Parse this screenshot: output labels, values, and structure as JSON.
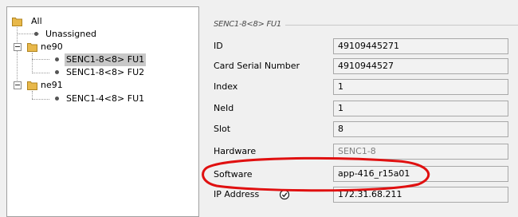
{
  "tree": {
    "root": {
      "label": "All"
    },
    "unassigned": {
      "label": "Unassigned"
    },
    "ne90": {
      "label": "ne90",
      "children": [
        {
          "label": "SENC1-8<8> FU1",
          "selected": true
        },
        {
          "label": "SENC1-8<8> FU2",
          "selected": false
        }
      ]
    },
    "ne91": {
      "label": "ne91",
      "children": [
        {
          "label": "SENC1-4<8> FU1",
          "selected": false
        }
      ]
    }
  },
  "details": {
    "section_title": "SENC1-8<8> FU1",
    "fields": [
      {
        "label": "ID",
        "value": "49109445271"
      },
      {
        "label": "Card Serial Number",
        "value": "4910944527"
      },
      {
        "label": "Index",
        "value": "1"
      },
      {
        "label": "NeId",
        "value": "1"
      },
      {
        "label": "Slot",
        "value": "8"
      },
      {
        "label": "Hardware",
        "value": "SENC1-8"
      },
      {
        "label": "Software",
        "value": "app-416_r15a01"
      },
      {
        "label": "IP Address",
        "value": "172.31.68.211"
      }
    ]
  },
  "colors": {
    "folder": "#e8b84a",
    "selection": "#c8c8c8",
    "annotation": "#e01010"
  },
  "icons": {
    "folder": "folder-icon",
    "ip_status": "check-circle-icon"
  }
}
